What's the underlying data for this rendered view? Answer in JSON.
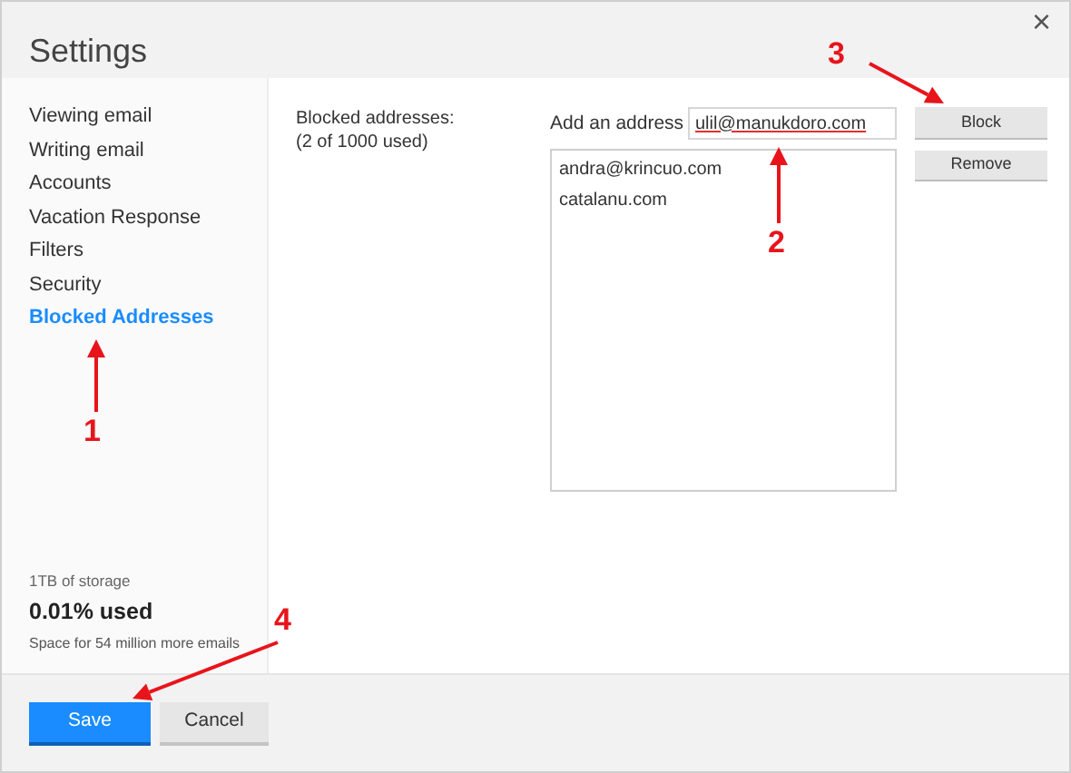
{
  "dialog": {
    "title": "Settings",
    "close": "×"
  },
  "sidebar": {
    "items": [
      {
        "label": "Viewing email",
        "selected": false
      },
      {
        "label": "Writing email",
        "selected": false
      },
      {
        "label": "Accounts",
        "selected": false
      },
      {
        "label": "Vacation Response",
        "selected": false
      },
      {
        "label": "Filters",
        "selected": false
      },
      {
        "label": "Security",
        "selected": false
      },
      {
        "label": "Blocked Addresses",
        "selected": true
      }
    ],
    "storage": {
      "caption": "1TB of storage",
      "used": "0.01% used",
      "note": "Space for 54 million more emails"
    }
  },
  "blocked": {
    "heading": "Blocked addresses:",
    "count": "(2 of 1000 used)",
    "add_label": "Add an address",
    "address_value": "ulil@manukdoro.com",
    "addresses": [
      "andra@krincuo.com",
      "catalanu.com"
    ],
    "block_button": "Block",
    "remove_button": "Remove"
  },
  "footer": {
    "save": "Save",
    "cancel": "Cancel"
  },
  "annotations": [
    "1",
    "2",
    "3",
    "4"
  ]
}
